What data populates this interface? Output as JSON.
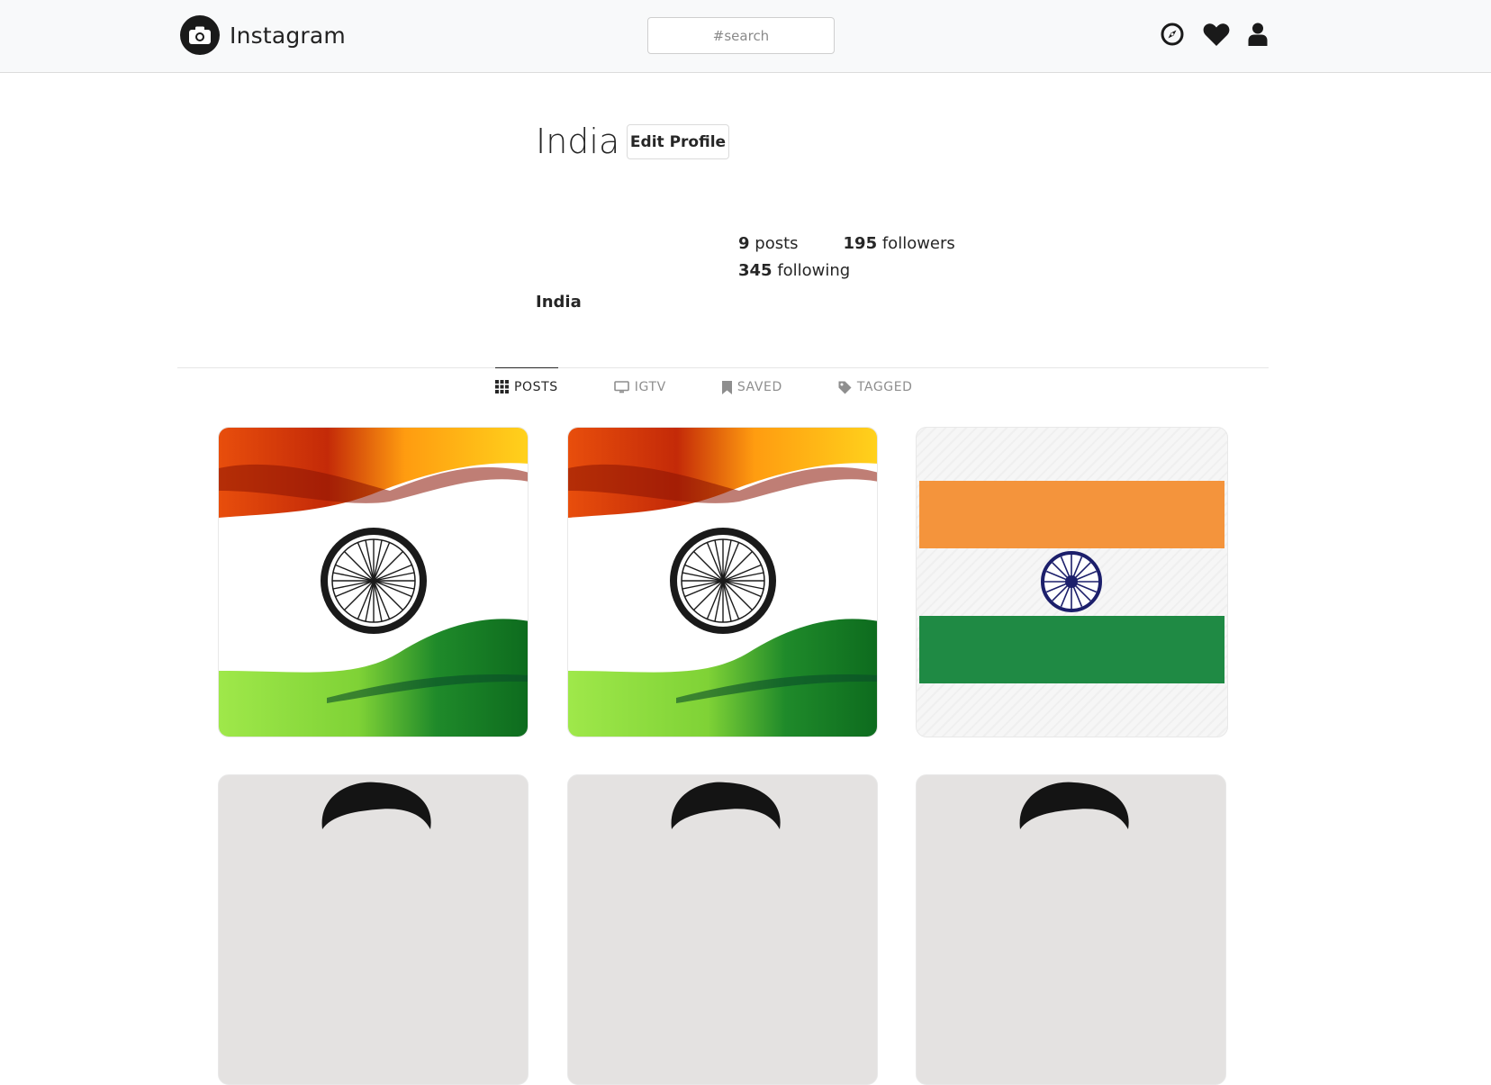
{
  "header": {
    "app_name": "Instagram",
    "search_placeholder": "#search",
    "icons": [
      "camera-icon",
      "compass-icon",
      "heart-icon",
      "user-icon"
    ]
  },
  "profile": {
    "username": "India",
    "edit_button": "Edit Profile",
    "posts_count": "9",
    "posts_label": "posts",
    "followers_count": "195",
    "followers_label": "followers",
    "following_count": "345",
    "following_label": "following",
    "full_name": "India"
  },
  "tabs": [
    {
      "label": "POSTS",
      "icon": "grid-icon",
      "active": true
    },
    {
      "label": "IGTV",
      "icon": "tv-icon",
      "active": false
    },
    {
      "label": "SAVED",
      "icon": "bookmark-icon",
      "active": false
    },
    {
      "label": "TAGGED",
      "icon": "tag-icon",
      "active": false
    }
  ],
  "posts": [
    {
      "kind": "wavy-flag"
    },
    {
      "kind": "wavy-flag"
    },
    {
      "kind": "flat-flag"
    },
    {
      "kind": "portrait"
    },
    {
      "kind": "portrait"
    },
    {
      "kind": "portrait"
    }
  ],
  "colors": {
    "saffron": "#f4943c",
    "green": "#1f8a44",
    "chakra_navy": "#1c1f6b",
    "header_bg": "#f8f9fa"
  }
}
